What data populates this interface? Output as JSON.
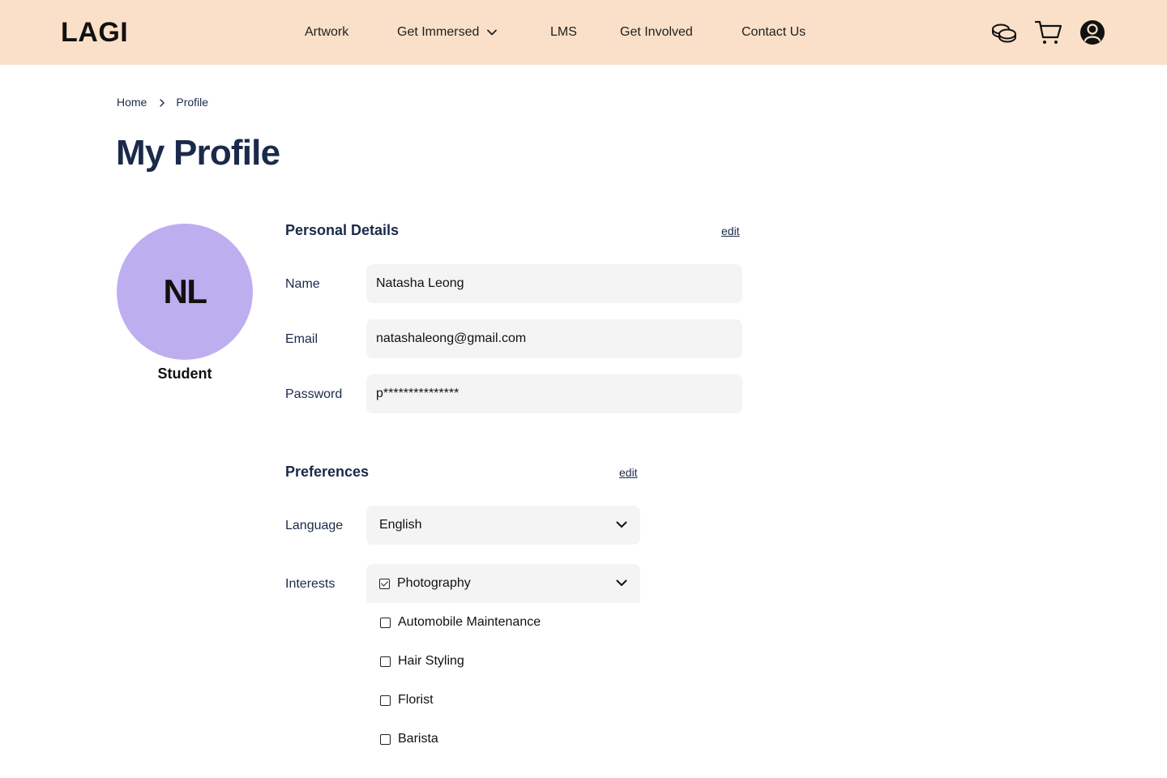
{
  "header": {
    "logo": "LAGI",
    "nav": [
      {
        "label": "Artwork"
      },
      {
        "label": "Get Immersed"
      },
      {
        "label": "LMS"
      },
      {
        "label": "Get Involved"
      },
      {
        "label": "Contact Us"
      }
    ],
    "icons": [
      "coins-icon",
      "cart-icon",
      "user-account-icon"
    ]
  },
  "breadcrumb": {
    "items": [
      "Home",
      "Profile"
    ]
  },
  "page": {
    "title": "My Profile"
  },
  "profile": {
    "initials": "NL",
    "role": "Student",
    "avatar_color": "#bdaef0"
  },
  "personal_details": {
    "title": "Personal Details",
    "edit_label": "edit",
    "name_label": "Name",
    "name_value": "Natasha Leong",
    "email_label": "Email",
    "email_value": "natashaleong@gmail.com",
    "password_label": "Password",
    "password_value": "p***************"
  },
  "preferences": {
    "title": "Preferences",
    "edit_label": "edit",
    "language_label": "Language",
    "language_value": "English",
    "interests_label": "Interests",
    "interests_selected": "Photography",
    "interest_options": [
      {
        "label": "Automobile Maintenance",
        "checked": false
      },
      {
        "label": "Hair Styling",
        "checked": false
      },
      {
        "label": "Florist",
        "checked": false
      },
      {
        "label": "Barista",
        "checked": false
      }
    ]
  },
  "colors": {
    "header_bg": "#fae0c8",
    "primary_text": "#1b2a4a",
    "input_bg": "#f4f4f4"
  }
}
